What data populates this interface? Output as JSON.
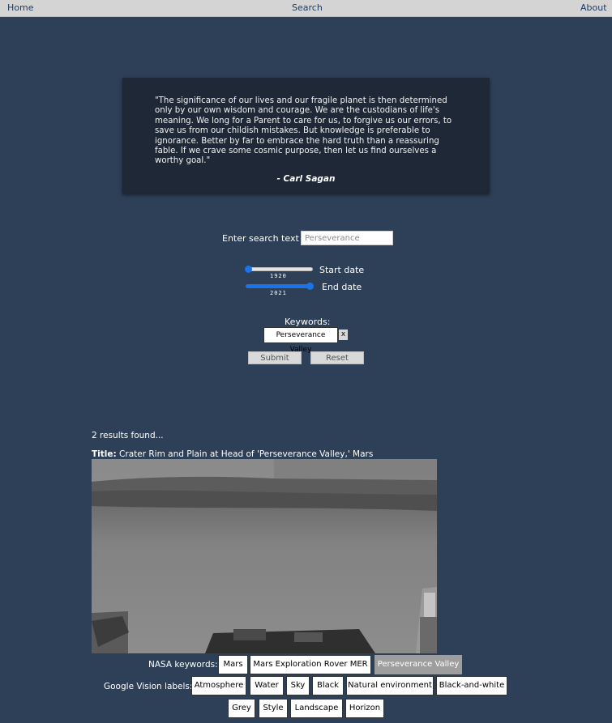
{
  "nav": {
    "home": "Home",
    "search": "Search",
    "about": "About"
  },
  "quote": {
    "text": "\"The significance of our lives and our fragile planet is then determined only by our own wisdom and courage. We are the custodians of life's meaning. We long for a Parent to care for us, to forgive us our errors, to save us from our childish mistakes. But knowledge is preferable to ignorance. Better by far to embrace the hard truth than a reassuring fable. If we crave some cosmic purpose, then let us find ourselves a worthy goal.\"",
    "author": "- Carl Sagan"
  },
  "search": {
    "label": "Enter search text",
    "placeholder": "Perseverance"
  },
  "dates": {
    "start_label": "Start date",
    "start_value": "1920",
    "end_label": "End date",
    "end_value": "2021"
  },
  "keywords": {
    "label": "Keywords:",
    "items": [
      "Perseverance Valley"
    ],
    "remove": "x"
  },
  "buttons": {
    "submit": "Submit",
    "reset": "Reset"
  },
  "results": {
    "count_text": "2 results found...",
    "items": [
      {
        "title_label": "Title:",
        "title": "Crater Rim and Plain at Head of 'Perseverance Valley,' Mars",
        "nasa_label": "NASA keywords:",
        "nasa_keywords": [
          "Mars",
          "Mars Exploration Rover MER",
          "Perseverance Valley"
        ],
        "vision_label": "Google Vision labels:",
        "vision_labels": [
          "Atmosphere",
          "Water",
          "Sky",
          "Black",
          "Natural environment",
          "Black-and-white",
          "Grey",
          "Style",
          "Landscape",
          "Horizon"
        ]
      }
    ]
  },
  "colors": {
    "background": "#2e4057",
    "quote_bg": "#1e2836",
    "accent": "#1a73e8",
    "active_tag": "#9e9e9e"
  }
}
